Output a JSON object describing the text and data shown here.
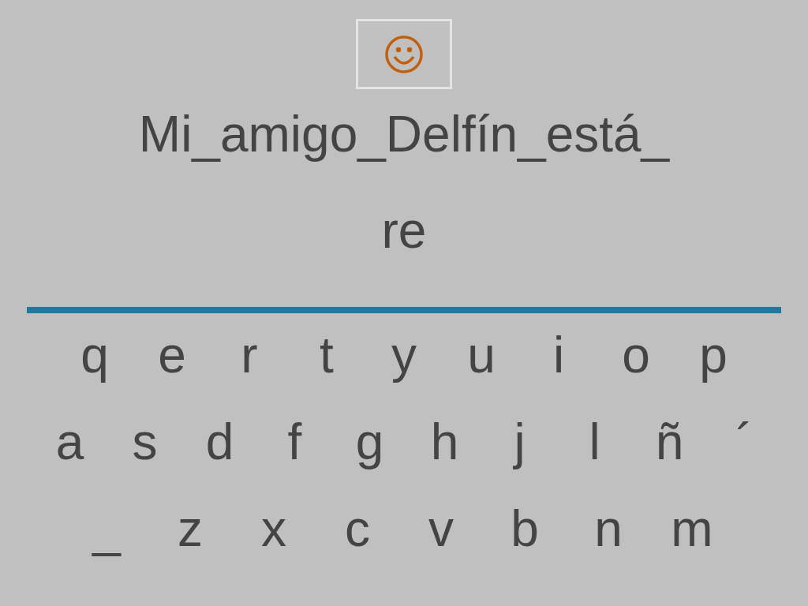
{
  "sentence": "Mi_amigo_Delfín_está_",
  "answer": "re",
  "keyboard_rows": [
    [
      "q",
      "e",
      "r",
      "t",
      "y",
      "u",
      "i",
      "o",
      "p"
    ],
    [
      "a",
      "s",
      "d",
      "f",
      "g",
      "h",
      "j",
      "l",
      "ñ",
      "´"
    ],
    [
      "_",
      "z",
      "x",
      "c",
      "v",
      "b",
      "n",
      "m"
    ]
  ]
}
